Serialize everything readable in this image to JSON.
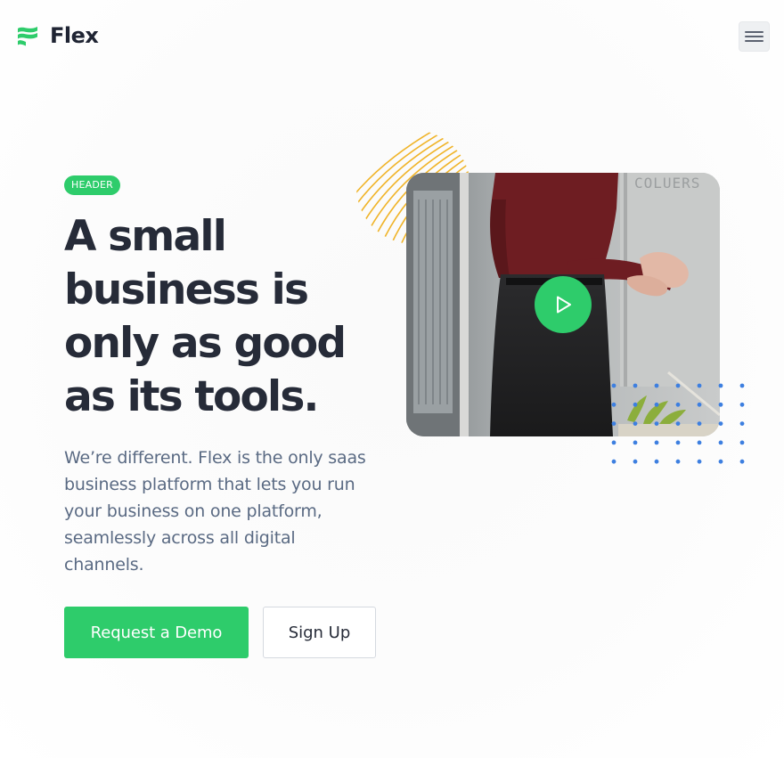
{
  "brand": {
    "name": "Flex",
    "accent_color": "#2ecc6b",
    "logo_icon": "flex-logo-icon"
  },
  "nav": {
    "menu_icon": "hamburger-menu-icon"
  },
  "hero": {
    "badge": "HEADER",
    "headline": "A small business is only as good as its tools.",
    "subtext": "We’re different. Flex is the only saas business platform that lets you run your business on one platform, seamlessly across all digital channels.",
    "primary_button": "Request a Demo",
    "secondary_button": "Sign Up"
  },
  "media": {
    "play_icon": "play-icon",
    "decor_swirl_color": "#f0b429",
    "decor_dots_color": "#3d7fe0",
    "watermark": "COLUERS"
  }
}
